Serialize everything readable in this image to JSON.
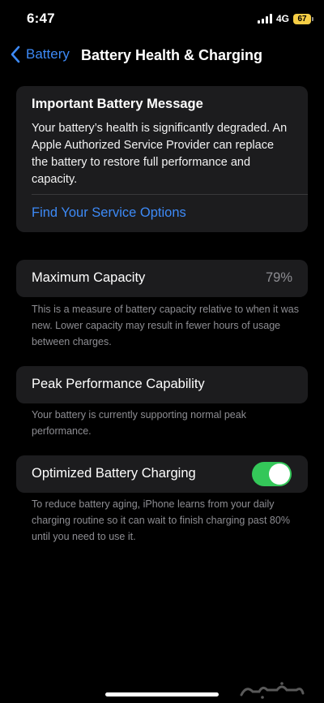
{
  "status_bar": {
    "time": "6:47",
    "network": "4G",
    "battery_level": "67",
    "battery_color": "#f7ce45"
  },
  "nav": {
    "back_label": "Battery",
    "title": "Battery Health & Charging"
  },
  "message_card": {
    "title": "Important Battery Message",
    "body": "Your battery’s health is significantly degraded. An Apple Authorized Service Provider can replace the battery to restore full performance and capacity.",
    "link": "Find Your Service Options"
  },
  "max_capacity": {
    "label": "Maximum Capacity",
    "value": "79%",
    "footnote": "This is a measure of battery capacity relative to when it was new. Lower capacity may result in fewer hours of usage between charges."
  },
  "peak_performance": {
    "label": "Peak Performance Capability",
    "footnote": "Your battery is currently supporting normal peak performance."
  },
  "optimized_charging": {
    "label": "Optimized Battery Charging",
    "enabled": true,
    "toggle_color": "#34c759",
    "footnote": "To reduce battery aging, iPhone learns from your daily charging routine so it can wait to finish charging past 80% until you need to use it."
  },
  "colors": {
    "accent": "#3d8af7",
    "card_bg": "#1c1c1e",
    "secondary_text": "#8d8d92"
  }
}
